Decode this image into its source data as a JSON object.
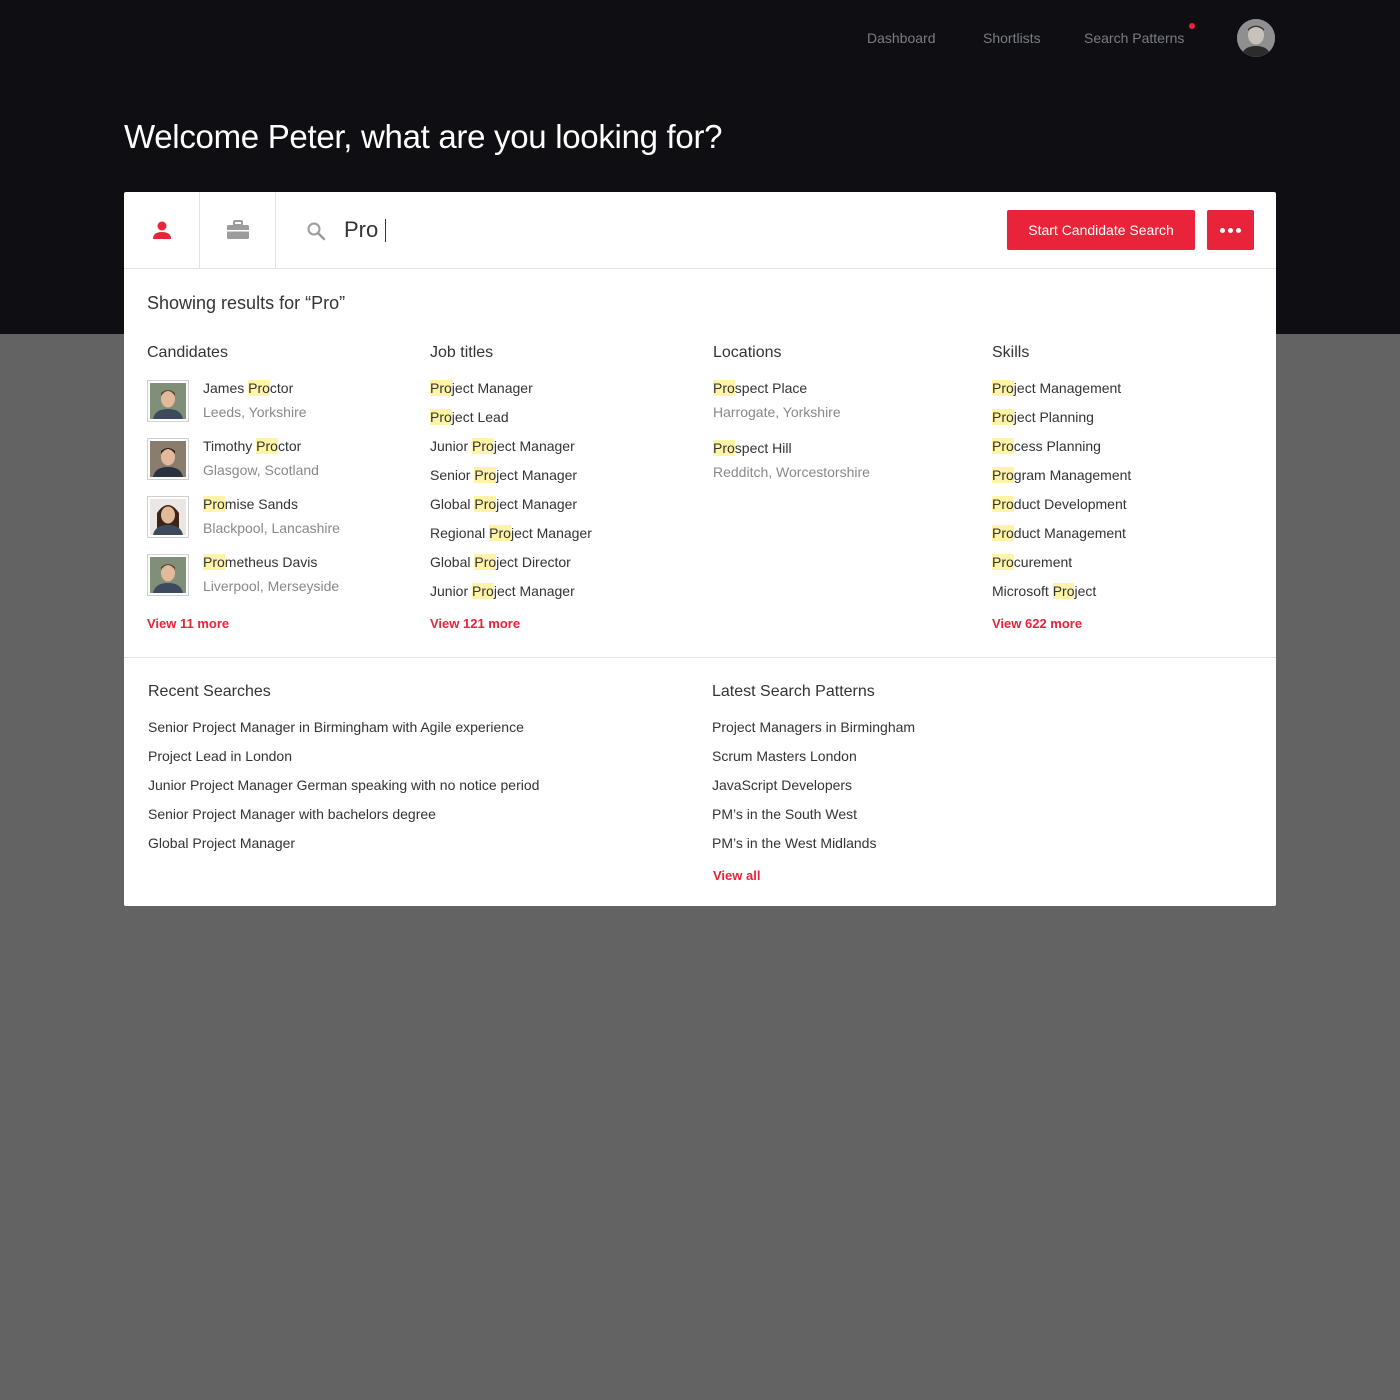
{
  "nav": {
    "items": [
      "Dashboard",
      "Shortlists",
      "Search Patterns"
    ]
  },
  "welcome": "Welcome Peter, what are you looking for?",
  "search": {
    "value": "Pro",
    "primary_label": "Start Candidate Search",
    "more_icon": "more-dots-icon",
    "tabs": [
      "person-icon",
      "briefcase-icon"
    ]
  },
  "results_title": "Showing results for “Pro”",
  "candidates": {
    "heading": "Candidates",
    "items": [
      {
        "pre": "James ",
        "hl": "Pro",
        "post": "ctor",
        "location": "Leeds, Yorkshire"
      },
      {
        "pre": "Timothy ",
        "hl": "Pro",
        "post": "ctor",
        "location": "Glasgow, Scotland"
      },
      {
        "pre": "",
        "hl": "Pro",
        "post": "mise Sands",
        "location": "Blackpool, Lancashire"
      },
      {
        "pre": "",
        "hl": "Pro",
        "post": "metheus Davis",
        "location": "Liverpool, Merseyside"
      }
    ],
    "view_more": "View 11 more"
  },
  "job_titles": {
    "heading": "Job titles",
    "items": [
      {
        "pre": "",
        "hl": "Pro",
        "post": "ject Manager"
      },
      {
        "pre": "",
        "hl": "Pro",
        "post": "ject Lead"
      },
      {
        "pre": "Junior ",
        "hl": "Pro",
        "post": "ject Manager"
      },
      {
        "pre": "Senior ",
        "hl": "Pro",
        "post": "ject Manager"
      },
      {
        "pre": "Global ",
        "hl": "Pro",
        "post": "ject Manager"
      },
      {
        "pre": "Regional ",
        "hl": "Pro",
        "post": "ject Manager"
      },
      {
        "pre": "Global ",
        "hl": "Pro",
        "post": "ject Director"
      },
      {
        "pre": "Junior ",
        "hl": "Pro",
        "post": "ject Manager"
      }
    ],
    "view_more": "View 121 more"
  },
  "locations": {
    "heading": "Locations",
    "items": [
      {
        "pre": "",
        "hl": "Pro",
        "post": "spect Place",
        "location": "Harrogate, Yorkshire"
      },
      {
        "pre": "",
        "hl": "Pro",
        "post": "spect Hill",
        "location": "Redditch, Worcestorshire"
      }
    ]
  },
  "skills": {
    "heading": "Skills",
    "items": [
      {
        "pre": "",
        "hl": "Pro",
        "post": "ject Management"
      },
      {
        "pre": "",
        "hl": "Pro",
        "post": "ject Planning"
      },
      {
        "pre": "",
        "hl": "Pro",
        "post": "cess Planning"
      },
      {
        "pre": "",
        "hl": "Pro",
        "post": "gram Management"
      },
      {
        "pre": "",
        "hl": "Pro",
        "post": "duct Development"
      },
      {
        "pre": "",
        "hl": "Pro",
        "post": "duct Management"
      },
      {
        "pre": "",
        "hl": "Pro",
        "post": "curement"
      },
      {
        "pre": "Microsoft ",
        "hl": "Pro",
        "post": "ject"
      }
    ],
    "view_more": "View 622 more"
  },
  "recent": {
    "heading": "Recent Searches",
    "items": [
      "Senior Project Manager in Birmingham with Agile experience",
      "Project Lead in London",
      "Junior Project Manager German speaking with no notice period",
      "Senior Project Manager with bachelors degree",
      "Global Project Manager"
    ]
  },
  "patterns": {
    "heading": "Latest Search Patterns",
    "items": [
      "Project Managers in Birmingham",
      "Scrum Masters London",
      "JavaScript Developers",
      "PM’s in the South West",
      "PM’s in the West Midlands"
    ],
    "view_all": "View all"
  },
  "colors": {
    "accent": "#e8233a",
    "header_bg": "#0e0e13",
    "page_bg": "#636363",
    "highlight": "#fff3a8"
  }
}
